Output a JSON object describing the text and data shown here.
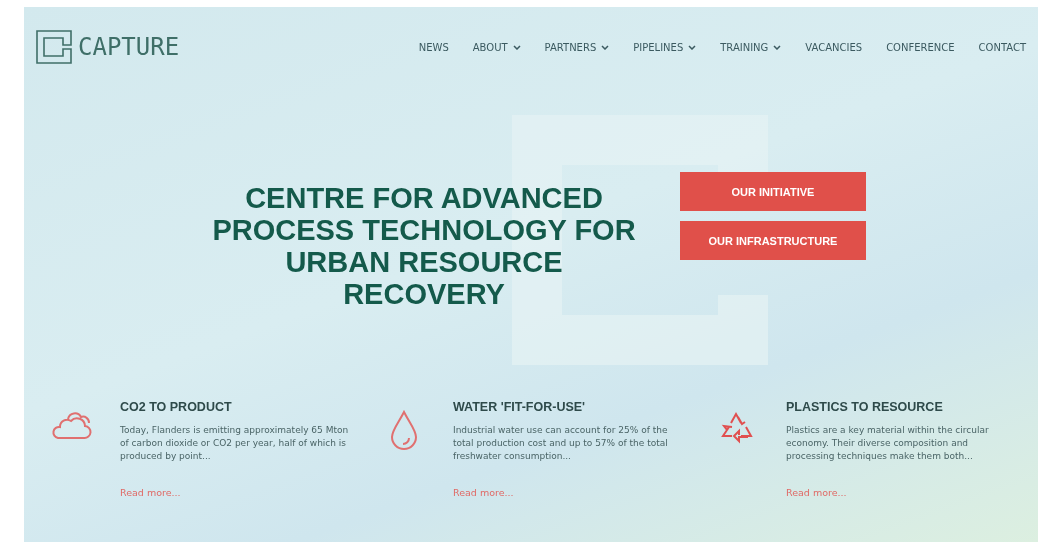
{
  "header": {
    "logo_text": "CAPTURE",
    "nav": [
      {
        "label": "NEWS",
        "dropdown": false
      },
      {
        "label": "ABOUT",
        "dropdown": true
      },
      {
        "label": "PARTNERS",
        "dropdown": true
      },
      {
        "label": "PIPELINES",
        "dropdown": true
      },
      {
        "label": "TRAINING",
        "dropdown": true
      },
      {
        "label": "VACANCIES",
        "dropdown": false
      },
      {
        "label": "CONFERENCE",
        "dropdown": false
      },
      {
        "label": "CONTACT",
        "dropdown": false
      }
    ]
  },
  "hero": {
    "title": "CENTRE FOR ADVANCED PROCESS TECHNOLOGY FOR URBAN RESOURCE RECOVERY",
    "buttons": [
      "OUR INITIATIVE",
      "OUR INFRASTRUCTURE"
    ]
  },
  "features": [
    {
      "kind": "cloud",
      "title": "CO2 TO PRODUCT",
      "text": "Today, Flanders is emitting approximately 65 Mton of carbon dioxide or CO2 per year, half of which is produced by point...",
      "link": "Read more..."
    },
    {
      "kind": "drop",
      "title": "WATER 'FIT-FOR-USE'",
      "text": "Industrial water use can account for 25% of the total production cost and up to 57% of the total freshwater consumption...",
      "link": "Read more..."
    },
    {
      "kind": "recycle",
      "title": "PLASTICS TO RESOURCE",
      "text": "Plastics are a key material within the circular economy. Their diverse composition and processing techniques make them both...",
      "link": "Read more..."
    }
  ]
}
